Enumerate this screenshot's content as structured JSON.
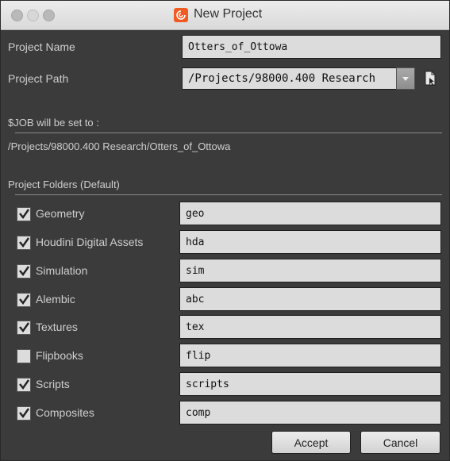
{
  "window": {
    "title": "New Project",
    "app_icon": "houdini-logo-icon"
  },
  "project_name": {
    "label": "Project Name",
    "value": "Otters_of_Ottowa"
  },
  "project_path": {
    "label": "Project Path",
    "value": "/Projects/98000.400 Research",
    "dropdown_icon": "chevron-down-icon",
    "browse_icon": "file-browse-icon"
  },
  "job": {
    "label": "$JOB will be set to :",
    "value": "/Projects/98000.400 Research/Otters_of_Ottowa"
  },
  "folders": {
    "heading": "Project Folders (Default)",
    "items": [
      {
        "label": "Geometry",
        "value": "geo",
        "checked": true
      },
      {
        "label": "Houdini Digital Assets",
        "value": "hda",
        "checked": true
      },
      {
        "label": "Simulation",
        "value": "sim",
        "checked": true
      },
      {
        "label": "Alembic",
        "value": "abc",
        "checked": true
      },
      {
        "label": "Textures",
        "value": "tex",
        "checked": true
      },
      {
        "label": "Flipbooks",
        "value": "flip",
        "checked": false
      },
      {
        "label": "Scripts",
        "value": "scripts",
        "checked": true
      },
      {
        "label": "Composites",
        "value": "comp",
        "checked": true
      }
    ]
  },
  "buttons": {
    "accept": "Accept",
    "cancel": "Cancel"
  },
  "colors": {
    "background": "#3b3b3b",
    "field": "#dcdcdc",
    "accent": "#f15a22"
  }
}
